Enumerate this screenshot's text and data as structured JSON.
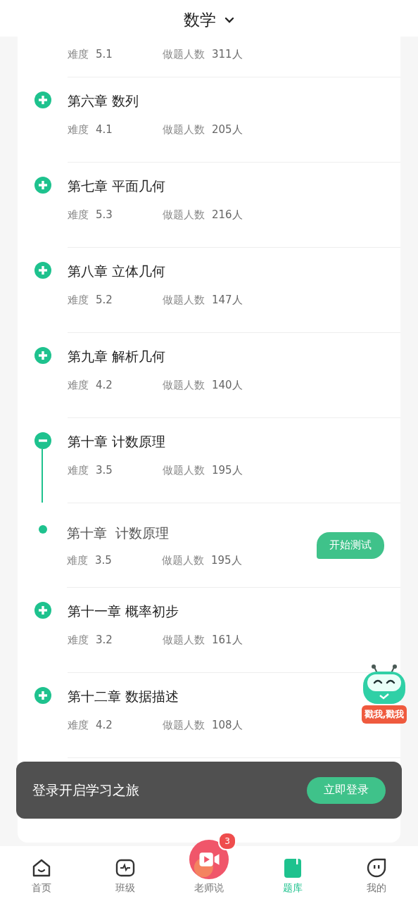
{
  "header": {
    "title": "数学"
  },
  "chapters": [
    {
      "difficulty_label": "难度",
      "difficulty": "5.1",
      "count_label": "做题人数",
      "count": "311人"
    },
    {
      "title": "第六章 数列",
      "difficulty_label": "难度",
      "difficulty": "4.1",
      "count_label": "做题人数",
      "count": "205人",
      "expanded": false
    },
    {
      "title": "第七章 平面几何",
      "difficulty_label": "难度",
      "difficulty": "5.3",
      "count_label": "做题人数",
      "count": "216人",
      "expanded": false
    },
    {
      "title": "第八章 立体几何",
      "difficulty_label": "难度",
      "difficulty": "5.2",
      "count_label": "做题人数",
      "count": "147人",
      "expanded": false
    },
    {
      "title": "第九章 解析几何",
      "difficulty_label": "难度",
      "difficulty": "4.2",
      "count_label": "做题人数",
      "count": "140人",
      "expanded": false
    },
    {
      "title": "第十章 计数原理",
      "difficulty_label": "难度",
      "difficulty": "3.5",
      "count_label": "做题人数",
      "count": "195人",
      "expanded": true,
      "children": [
        {
          "title": "第十章  计数原理",
          "difficulty_label": "难度",
          "difficulty": "3.5",
          "count_label": "做题人数",
          "count": "195人",
          "button": "开始测试"
        }
      ]
    },
    {
      "title": "第十一章 概率初步",
      "difficulty_label": "难度",
      "difficulty": "3.2",
      "count_label": "做题人数",
      "count": "161人",
      "expanded": false
    },
    {
      "title": "第十二章 数据描述",
      "difficulty_label": "难度",
      "difficulty": "4.2",
      "count_label": "做题人数",
      "count": "108人",
      "expanded": false
    }
  ],
  "mascot": {
    "label": "戳我,戳我"
  },
  "toast": {
    "text": "登录开启学习之旅",
    "button": "立即登录"
  },
  "tabs": [
    {
      "kind": "home",
      "label": "首页",
      "selected": false
    },
    {
      "kind": "class",
      "label": "班级",
      "selected": false
    },
    {
      "kind": "video",
      "label": "老师说",
      "selected": false,
      "badge": "3"
    },
    {
      "kind": "bank",
      "label": "题库",
      "selected": true
    },
    {
      "kind": "mine",
      "label": "我的",
      "selected": false
    }
  ]
}
